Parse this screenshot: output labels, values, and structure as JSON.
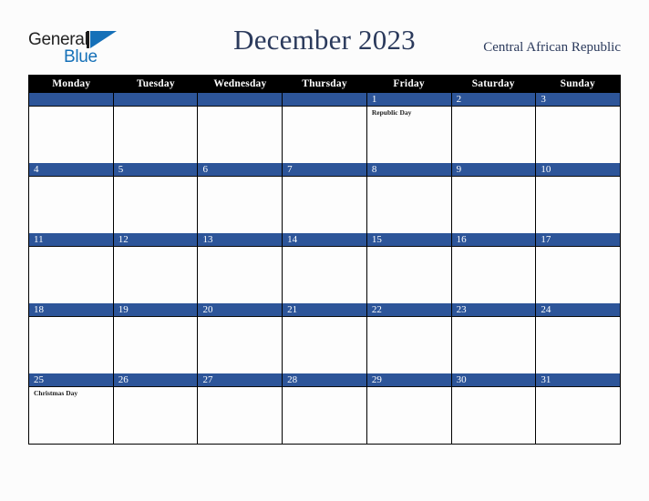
{
  "logo": {
    "word_one": "General",
    "word_two": "Blue",
    "triangle_icon": "blue-triangle-icon",
    "brand_blue": "#1570b8",
    "brand_dark": "#232323"
  },
  "header": {
    "title": "December 2023",
    "country": "Central African Republic",
    "title_color": "#2b3a5c"
  },
  "calendar": {
    "weekday_headers": [
      "Monday",
      "Tuesday",
      "Wednesday",
      "Thursday",
      "Friday",
      "Saturday",
      "Sunday"
    ],
    "header_bg": "#000000",
    "date_band_bg": "#2d5599",
    "weeks": [
      {
        "days": [
          {
            "date": "",
            "events": []
          },
          {
            "date": "",
            "events": []
          },
          {
            "date": "",
            "events": []
          },
          {
            "date": "",
            "events": []
          },
          {
            "date": "1",
            "events": [
              "Republic Day"
            ]
          },
          {
            "date": "2",
            "events": []
          },
          {
            "date": "3",
            "events": []
          }
        ]
      },
      {
        "days": [
          {
            "date": "4",
            "events": []
          },
          {
            "date": "5",
            "events": []
          },
          {
            "date": "6",
            "events": []
          },
          {
            "date": "7",
            "events": []
          },
          {
            "date": "8",
            "events": []
          },
          {
            "date": "9",
            "events": []
          },
          {
            "date": "10",
            "events": []
          }
        ]
      },
      {
        "days": [
          {
            "date": "11",
            "events": []
          },
          {
            "date": "12",
            "events": []
          },
          {
            "date": "13",
            "events": []
          },
          {
            "date": "14",
            "events": []
          },
          {
            "date": "15",
            "events": []
          },
          {
            "date": "16",
            "events": []
          },
          {
            "date": "17",
            "events": []
          }
        ]
      },
      {
        "days": [
          {
            "date": "18",
            "events": []
          },
          {
            "date": "19",
            "events": []
          },
          {
            "date": "20",
            "events": []
          },
          {
            "date": "21",
            "events": []
          },
          {
            "date": "22",
            "events": []
          },
          {
            "date": "23",
            "events": []
          },
          {
            "date": "24",
            "events": []
          }
        ]
      },
      {
        "days": [
          {
            "date": "25",
            "events": [
              "Christmas Day"
            ]
          },
          {
            "date": "26",
            "events": []
          },
          {
            "date": "27",
            "events": []
          },
          {
            "date": "28",
            "events": []
          },
          {
            "date": "29",
            "events": []
          },
          {
            "date": "30",
            "events": []
          },
          {
            "date": "31",
            "events": []
          }
        ]
      }
    ]
  }
}
